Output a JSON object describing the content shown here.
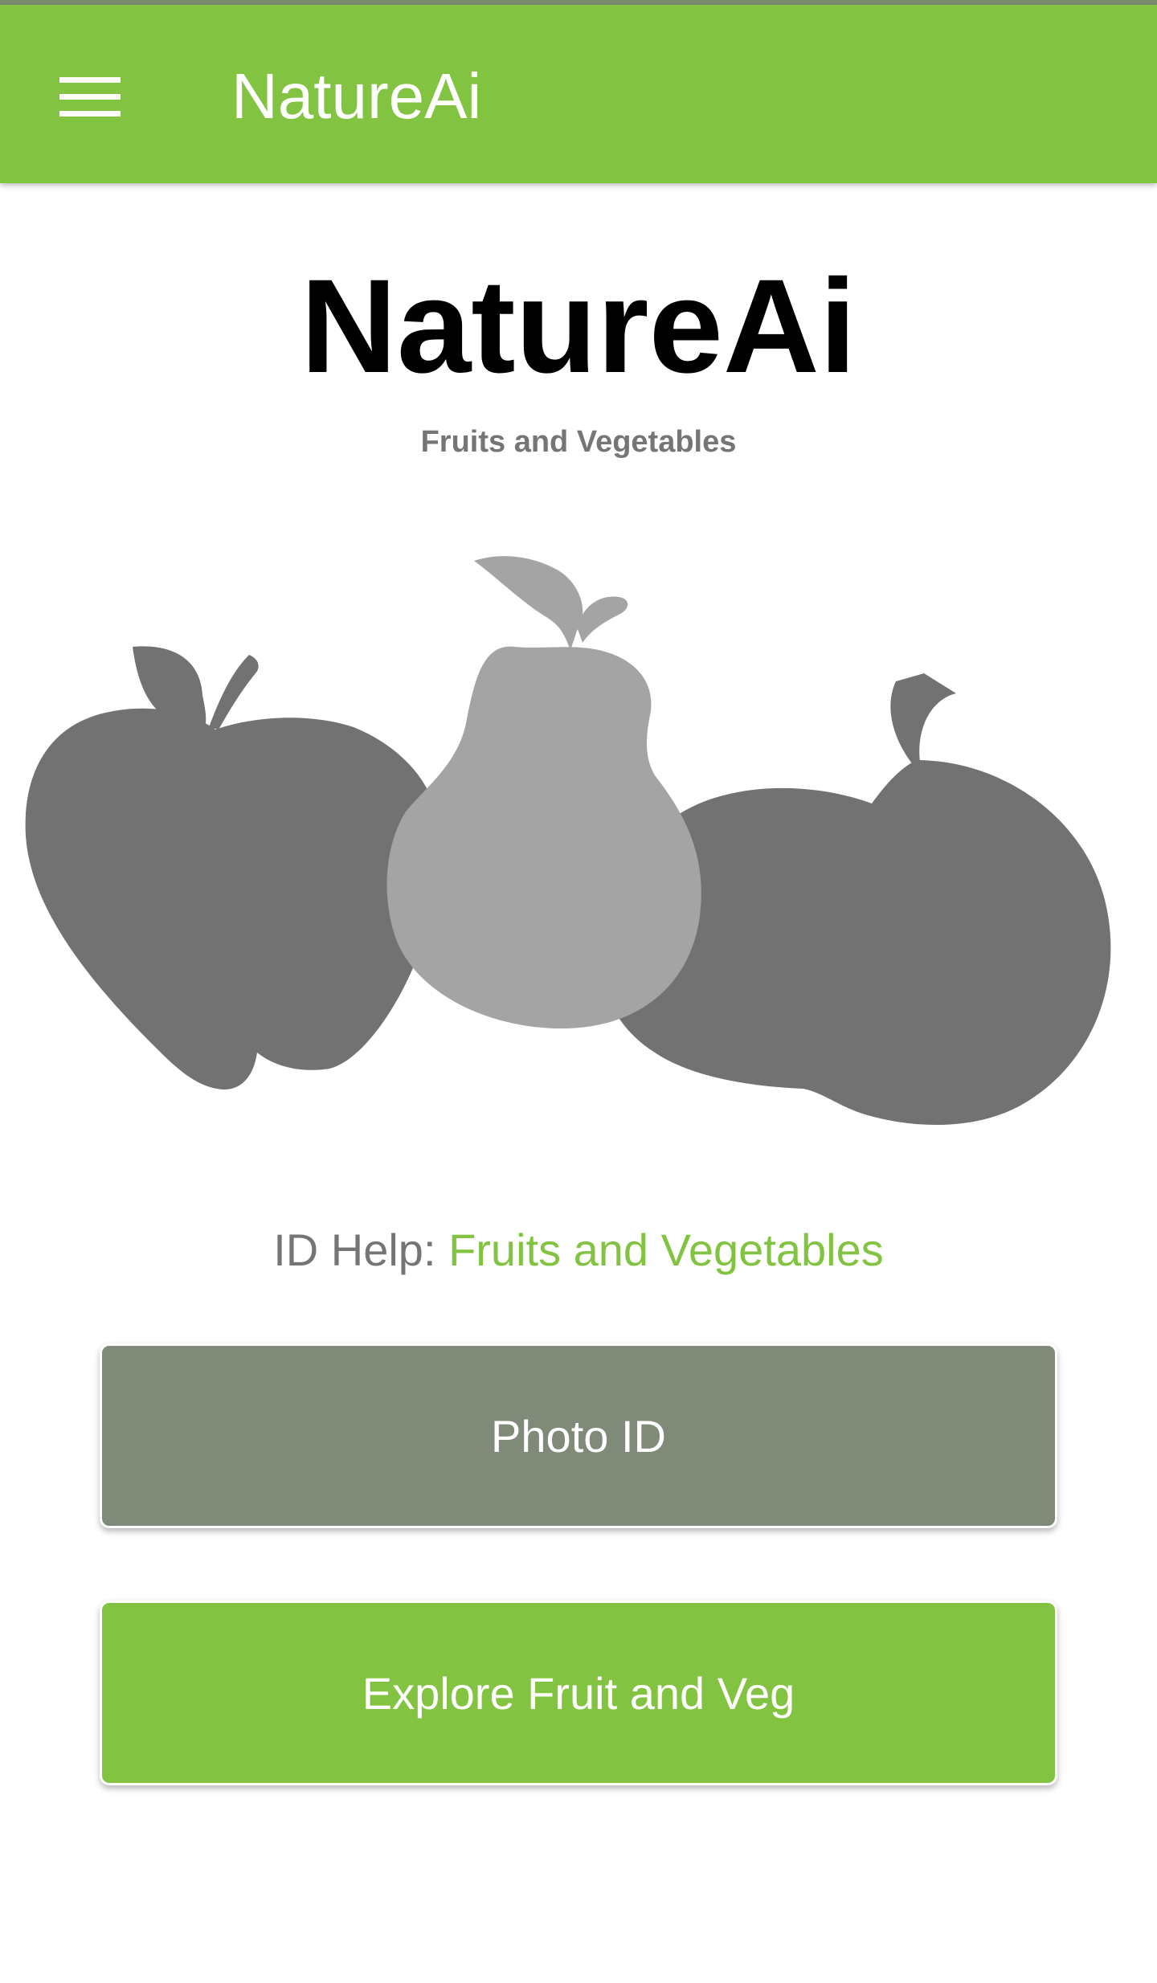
{
  "app_bar": {
    "title": "NatureAi",
    "menu_icon": "hamburger-menu-icon",
    "background_color": "#82c341"
  },
  "hero": {
    "title": "NatureAi",
    "subtitle": "Fruits and Vegetables"
  },
  "illustration": {
    "icons": [
      "apple-icon",
      "pear-icon",
      "tomato-icon"
    ],
    "dark_gray": "#727272",
    "light_gray": "#a4a4a4"
  },
  "id_help": {
    "prefix": "ID Help: ",
    "value": "Fruits and Vegetables",
    "accent_color": "#82c341"
  },
  "buttons": {
    "photo_id": {
      "label": "Photo ID",
      "color": "#808a78"
    },
    "explore": {
      "label": "Explore Fruit and Veg",
      "color": "#82c341"
    }
  }
}
